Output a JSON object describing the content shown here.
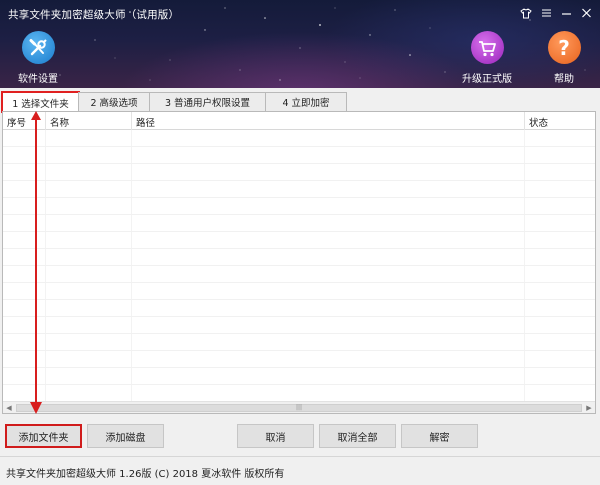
{
  "window": {
    "title": "共享文件夹加密超级大师（试用版）",
    "controls": [
      "shirt-icon",
      "menu-icon",
      "minimize-icon",
      "close-icon"
    ]
  },
  "toolbar": {
    "settings_label": "软件设置",
    "upgrade_label": "升级正式版",
    "help_label": "帮助"
  },
  "tabs": [
    {
      "label": "1 选择文件夹",
      "active": true
    },
    {
      "label": "2 高级选项",
      "active": false
    },
    {
      "label": "3 普通用户权限设置",
      "active": false
    },
    {
      "label": "4 立即加密",
      "active": false
    }
  ],
  "table": {
    "columns": [
      "序号",
      "名称",
      "路径",
      "状态"
    ],
    "rows": []
  },
  "buttons": {
    "add_folder": "添加文件夹",
    "add_disk": "添加磁盘",
    "cancel": "取消",
    "cancel_all": "取消全部",
    "decrypt": "解密"
  },
  "status": {
    "text": "共享文件夹加密超级大师 1.26版 (C) 2018 夏冰软件 版权所有"
  },
  "colors": {
    "settings_icon_bg": "#2a8fd8",
    "upgrade_icon_bg": "#b13ad1",
    "help_icon_bg": "#f0752e",
    "annotation": "#d81e1e"
  }
}
